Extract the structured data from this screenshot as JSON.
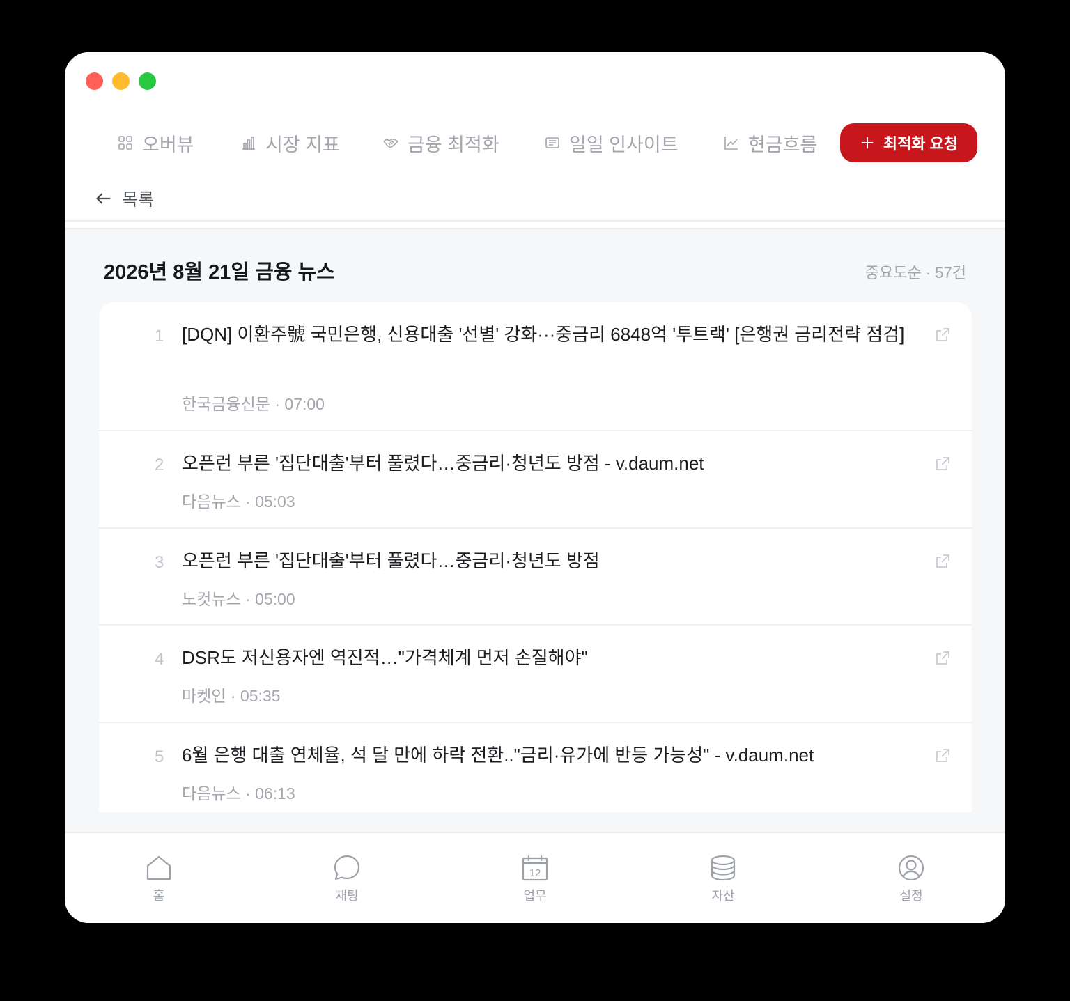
{
  "nav": {
    "items": [
      {
        "label": "오버뷰",
        "icon": "grid-icon"
      },
      {
        "label": "시장 지표",
        "icon": "bar-chart-icon"
      },
      {
        "label": "금융 최적화",
        "icon": "handshake-icon"
      },
      {
        "label": "일일 인사이트",
        "icon": "newspaper-icon"
      },
      {
        "label": "현금흐름",
        "icon": "trend-icon"
      }
    ],
    "cta_label": "최적화 요청"
  },
  "back": {
    "label": "목록"
  },
  "page": {
    "title": "2026년 8월 21일 금융 뉴스",
    "sort_meta": "중요도순 · 57건"
  },
  "news": [
    {
      "rank": "1",
      "title": "[DQN] 이환주號 국민은행, 신용대출 '선별' 강화···중금리 6848억 '투트랙' [은행권 금리전략 점검]",
      "source": "한국금융신문 · 07:00"
    },
    {
      "rank": "2",
      "title": "오픈런 부른 '집단대출'부터 풀렸다…중금리·청년도 방점 - v.daum.net",
      "source": "다음뉴스 · 05:03"
    },
    {
      "rank": "3",
      "title": "오픈런 부른 '집단대출'부터 풀렸다…중금리·청년도 방점",
      "source": "노컷뉴스 · 05:00"
    },
    {
      "rank": "4",
      "title": "DSR도 저신용자엔 역진적…\"가격체계 먼저 손질해야\"",
      "source": "마켓인 · 05:35"
    },
    {
      "rank": "5",
      "title": "6월 은행 대출 연체율, 석 달 만에 하락 전환..\"금리·유가에 반등 가능성\" - v.daum.net",
      "source": "다음뉴스 · 06:13"
    }
  ],
  "tabbar": [
    {
      "label": "홈",
      "icon": "home-icon"
    },
    {
      "label": "채팅",
      "icon": "chat-icon"
    },
    {
      "label": "업무",
      "icon": "calendar-icon",
      "badge": "12"
    },
    {
      "label": "자산",
      "icon": "coins-icon"
    },
    {
      "label": "설정",
      "icon": "user-circle-icon"
    }
  ],
  "colors": {
    "accent": "#c8161d",
    "muted": "#a3a6ad",
    "text": "#1b1d21"
  }
}
